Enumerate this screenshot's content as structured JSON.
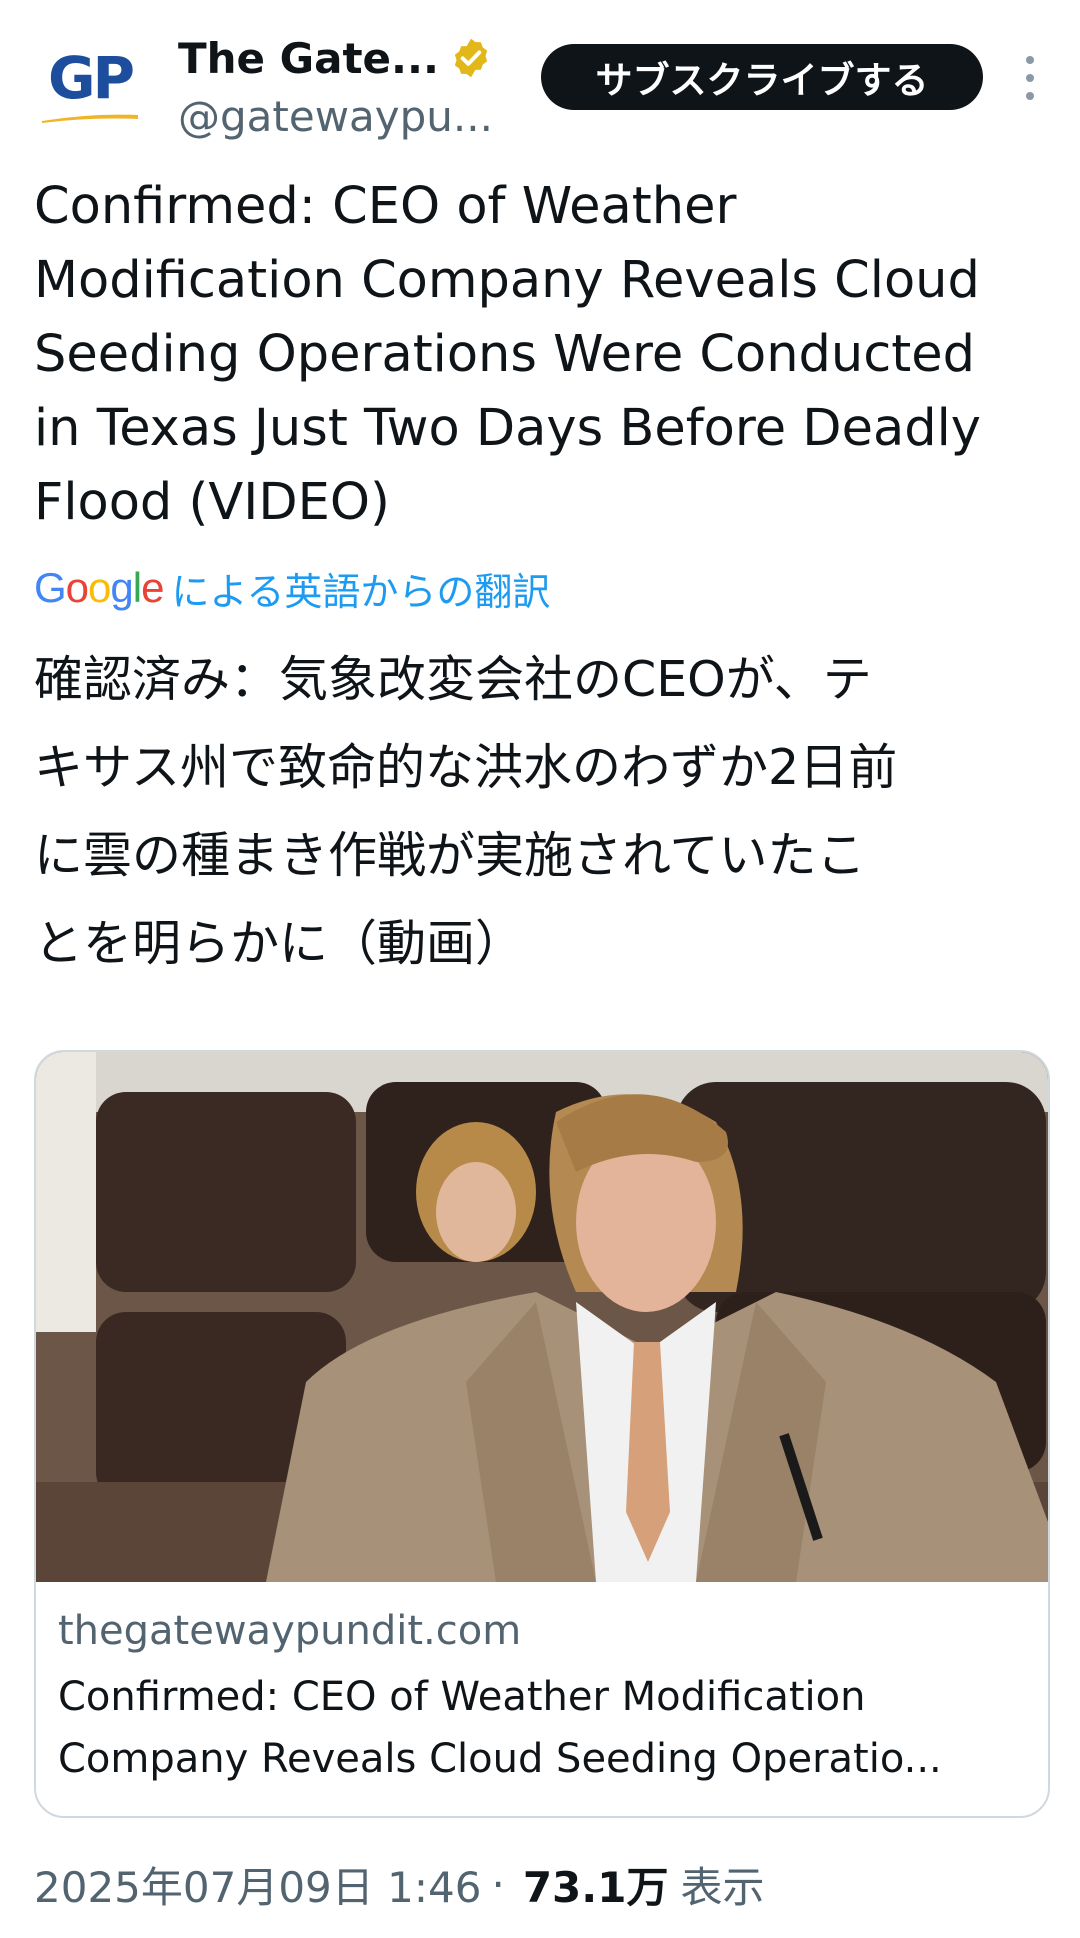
{
  "author": {
    "display_name": "The Gate...",
    "handle": "@gatewaypu...",
    "avatar_text": "GP",
    "verified_icon": "verified-gold-badge-icon"
  },
  "header": {
    "subscribe_label": "サブスクライブする",
    "more_icon": "more-vertical-icon"
  },
  "tweet": {
    "text_lines": [
      "Confirmed: CEO of Weather",
      "Modification Company Reveals Cloud",
      "Seeding Operations Were Conducted",
      "in Texas Just Two Days Before Deadly",
      "Flood (VIDEO)"
    ],
    "translation_label": "による英語からの翻訳",
    "translation_provider": "Google",
    "translated_lines": [
      "確認済み：気象改変会社のCEOが、テ",
      "キサス州で致命的な洪水のわずか2日前",
      "に雲の種まき作戦が実施されていたこ",
      "とを明らかに（動画）"
    ]
  },
  "card": {
    "domain": "thegatewaypundit.com",
    "title_line1": "Confirmed: CEO of Weather Modification",
    "title_line2": "Company Reveals Cloud Seeding Operatio..."
  },
  "meta": {
    "timestamp": "2025年07月09日 1:46",
    "separator": "·",
    "views_count": "73.1万",
    "views_label": "表示"
  },
  "colors": {
    "accent_blue": "#1d9bf0",
    "text_primary": "#0f1419",
    "text_secondary": "#536471",
    "border": "#cfd9de",
    "verified_gold": "#e2b719"
  }
}
